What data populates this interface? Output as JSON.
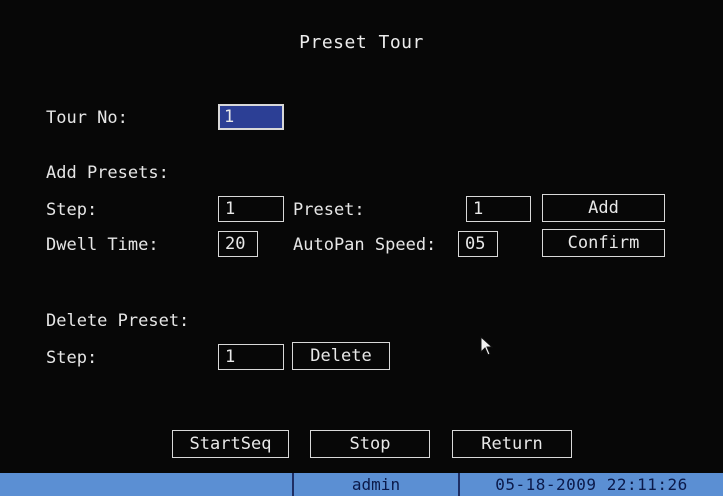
{
  "dialog": {
    "title": "Preset Tour"
  },
  "tour": {
    "label": "Tour No:",
    "value": "1"
  },
  "add_presets": {
    "section_label": "Add Presets:",
    "step_label": "Step:",
    "step_value": "1",
    "preset_label": "Preset:",
    "preset_value": "1",
    "add_button": "Add",
    "dwell_label": "Dwell Time:",
    "dwell_value": "20",
    "speed_label": "AutoPan Speed:",
    "speed_value": "05",
    "confirm_button": "Confirm"
  },
  "delete_preset": {
    "section_label": "Delete Preset:",
    "step_label": "Step:",
    "step_value": "1",
    "delete_button": "Delete"
  },
  "footer_buttons": {
    "start": "StartSeq",
    "stop": "Stop",
    "return": "Return"
  },
  "status_bar": {
    "user": "admin",
    "datetime": "05-18-2009 22:11:26"
  },
  "colors": {
    "background": "#070707",
    "selected_field": "#2c3f95",
    "status_bar": "#5b8fd3"
  },
  "icons": {
    "pointer": "mouse-pointer-icon"
  }
}
